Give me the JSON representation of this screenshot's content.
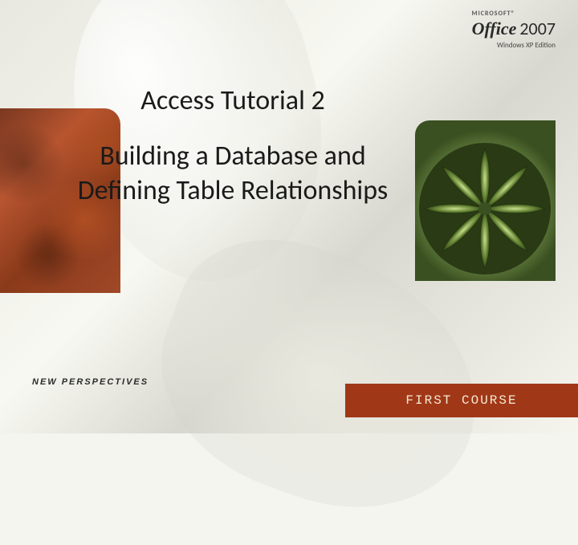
{
  "logo": {
    "brand_prefix": "MICROSOFT®",
    "brand_name": "Office",
    "brand_year": "2007",
    "edition": "Windows XP Edition"
  },
  "title": {
    "line1": "Access Tutorial 2",
    "line2": "Building a Database and Defining Table Relationships"
  },
  "series_label": "NEW PERSPECTIVES",
  "footer": {
    "label": "FIRST COURSE"
  },
  "colors": {
    "accent": "#a03818",
    "footer_text": "#f5e8d0"
  }
}
